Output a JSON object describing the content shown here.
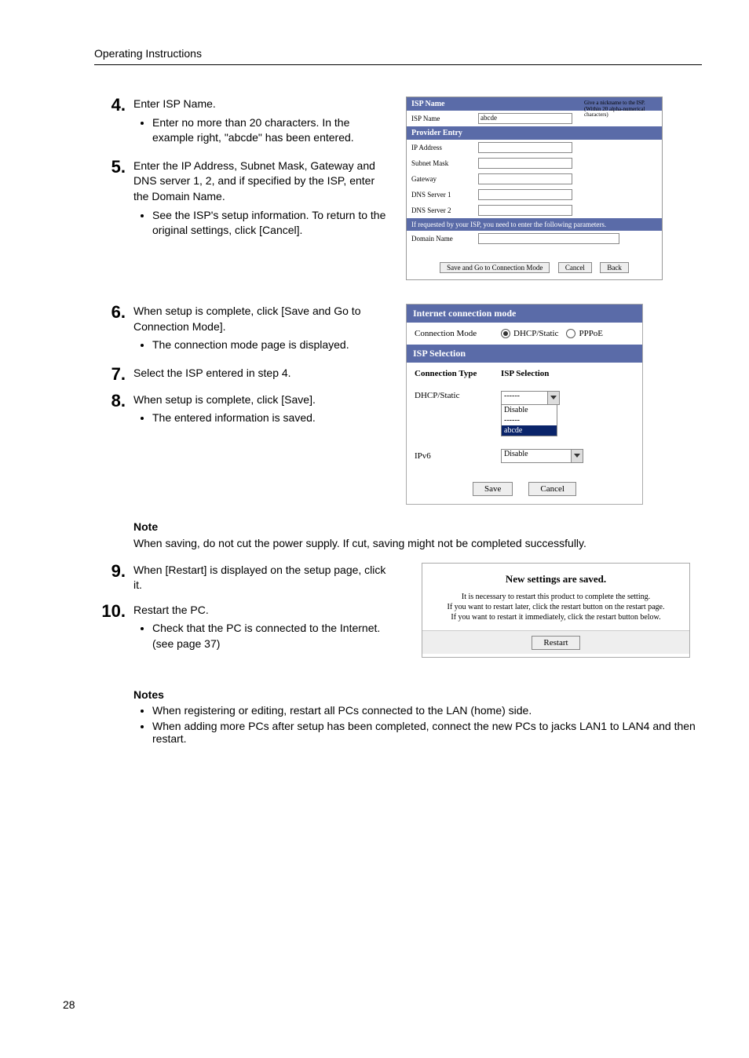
{
  "header": {
    "title": "Operating Instructions"
  },
  "steps": {
    "s4": {
      "num": "4.",
      "text": "Enter ISP Name.",
      "bullets": [
        "Enter no more than 20 characters. In the example right, \"abcde\" has been entered."
      ]
    },
    "s5": {
      "num": "5.",
      "text": "Enter the IP Address, Subnet Mask, Gateway and DNS server 1, 2, and if specified by the ISP, enter the Domain Name.",
      "bullets": [
        "See the ISP's setup information. To return to the original settings, click [Cancel]."
      ]
    },
    "s6": {
      "num": "6.",
      "text": "When setup is complete, click [Save and Go to Connection Mode].",
      "bullets": [
        "The connection mode page is displayed."
      ]
    },
    "s7": {
      "num": "7.",
      "text": "Select the ISP entered in step 4."
    },
    "s8": {
      "num": "8.",
      "text": "When setup is complete, click [Save].",
      "bullets": [
        "The entered information is saved."
      ]
    },
    "s9": {
      "num": "9.",
      "text": "When [Restart] is displayed on the setup page, click it."
    },
    "s10": {
      "num": "10.",
      "text": "Restart the PC.",
      "bullets": [
        "Check that the PC is connected to the Internet. (see page 37)"
      ]
    }
  },
  "form1": {
    "header_isp": "ISP Name",
    "side_note": "Give a nickname to the ISP. (Within 20 alpha-numerical characters)",
    "lbl_isp": "ISP Name",
    "val_isp": "abcde",
    "header_provider": "Provider Entry",
    "lbl_ip": "IP Address",
    "lbl_subnet": "Subnet Mask",
    "lbl_gateway": "Gateway",
    "lbl_dns1": "DNS Server 1",
    "lbl_dns2": "DNS Server 2",
    "param_note": "If requested by your ISP, you need to enter the following parameters.",
    "lbl_domain": "Domain Name",
    "btn_save_go": "Save and Go to Connection Mode",
    "btn_cancel": "Cancel",
    "btn_back": "Back"
  },
  "form2": {
    "header_mode": "Internet connection mode",
    "lbl_mode": "Connection Mode",
    "radio_dhcp": "DHCP/Static",
    "radio_pppoe": "PPPoE",
    "header_sel": "ISP Selection",
    "col_type": "Connection Type",
    "col_sel": "ISP Selection",
    "row_dhcp": "DHCP/Static",
    "dd_placeholder": "------",
    "dd_opt_disable": "Disable",
    "dd_opt_dashes": "------",
    "dd_opt_abcde": "abcde",
    "row_ipv6": "IPv6",
    "dd_ipv6": "Disable",
    "btn_save": "Save",
    "btn_cancel": "Cancel"
  },
  "note1": {
    "heading": "Note",
    "text": "When saving, do not cut the power supply. If cut, saving might not be completed successfully."
  },
  "restart": {
    "title": "New settings are saved.",
    "msg1": "It is necessary to restart this product to complete the setting.",
    "msg2": "If you want to restart later, click the restart button on the restart page.",
    "msg3": "If you want to restart it immediately, click the restart button below.",
    "btn": "Restart"
  },
  "notes2": {
    "heading": "Notes",
    "items": [
      "When registering or editing, restart all PCs connected to the LAN (home) side.",
      "When adding more PCs after setup has been completed, connect the new PCs to jacks LAN1 to LAN4 and then restart."
    ]
  },
  "page_number": "28"
}
